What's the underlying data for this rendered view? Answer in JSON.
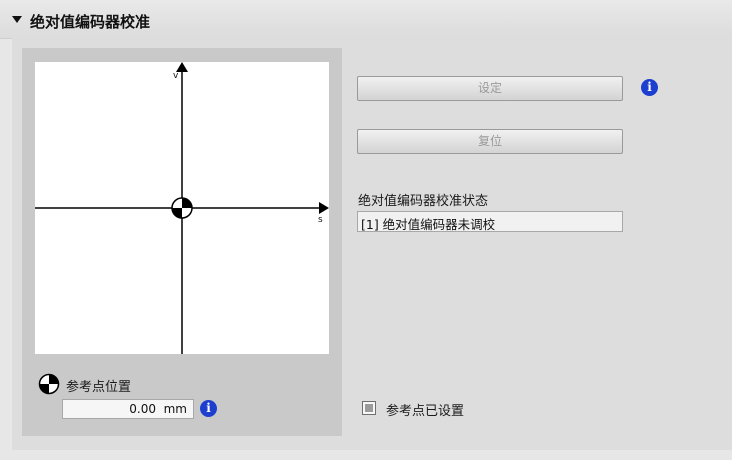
{
  "section": {
    "title": "绝对值编码器校准"
  },
  "plot": {
    "y_axis_label": "v",
    "x_axis_label": "s"
  },
  "reference_point": {
    "label": "参考点位置",
    "value": "0.00",
    "unit": "mm"
  },
  "buttons": {
    "set_label": "设定",
    "reset_label": "复位"
  },
  "status": {
    "label": "绝对值编码器校准状态",
    "value": "[1] 绝对值编码器未调校"
  },
  "checkbox": {
    "label": "参考点已设置",
    "checked": false
  },
  "info": {
    "glyph": "i"
  },
  "colors": {
    "info_blue": "#1d3fcf",
    "disabled_text": "#9a9a9a"
  }
}
